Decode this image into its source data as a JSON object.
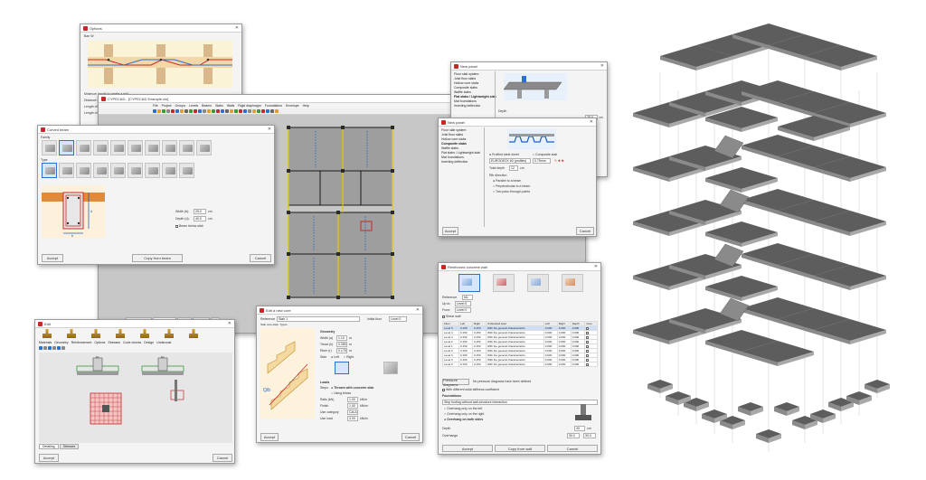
{
  "options_window": {
    "title": "Options",
    "section": "Ban W",
    "rows": [
      "Minimum length to create a mid...",
      "Distance between the lowest of 1...",
      "Length of the mid-span flat rod 0...",
      "Length of the bottom rebar..."
    ]
  },
  "main_window": {
    "title": "CYPECAD - [CYPECAD Example.cin]",
    "menu": [
      "File",
      "Project",
      "Groups",
      "Levels",
      "Beams",
      "Slabs",
      "Walls",
      "Rigid diaphragm",
      "Foundations",
      "Envelope",
      "Help"
    ],
    "bottom_tabs": [
      "Columns, Walls...",
      "Beams / Floors",
      "Results",
      "Isovalues",
      "3D"
    ],
    "status": "CYPECAD - CIVIL"
  },
  "curved_beam_window": {
    "title": "Curved beam",
    "family_label": "Family",
    "type_label": "Type",
    "width_label": "Width (b):",
    "width_value": "25.0",
    "width_unit": "cm",
    "depth_label": "Depth (d):",
    "depth_value": "40.0",
    "depth_unit": "cm",
    "below_slab_label": "Beam below slab",
    "accept": "Accept",
    "copy": "Copy from beam",
    "cancel": "Cancel",
    "dim_b": "b",
    "dim_d": "d"
  },
  "slab_window_1": {
    "title": "New panel",
    "tree": [
      "Floor slab system",
      "Joist floor slabs",
      "Hollow core slabs",
      "Composite slabs",
      "Waffle slabs",
      "Flat slabs / Lightweight slab",
      "Mat foundations",
      "Inverting deflection"
    ],
    "depth_label": "Depth",
    "depth_value": "25.0",
    "depth_unit": "cm",
    "lightweight": "Lightweight slab",
    "direction_label": "Direction of the longitudinal reinforcement",
    "opt1": "Parallel to a beam",
    "opt2": "Perpendicular to a beam"
  },
  "slab_window_2": {
    "title": "New panel",
    "tree": [
      "Floor slab system",
      "Joist floor slabs",
      "Hollow core slabs",
      "Composite slabs",
      "Waffle slabs",
      "Flat slabs / Lightweight slab",
      "Mat foundations",
      "Inverting deflection"
    ],
    "sheet_type": "Profiled steel sheet",
    "composite": "Composite slab",
    "profile": "EURODECK 60 (profiles)",
    "thickness": "0.75mm",
    "total_depth_label": "Total depth",
    "total_depth_value": "12",
    "total_depth_unit": "cm",
    "direction_label": "Rib direction",
    "opt1": "Parallel to a beam",
    "opt2": "Perpendicular to a beam",
    "opt3": "Two pass through points",
    "accept": "Accept",
    "cancel": "Cancel"
  },
  "wall_window": {
    "title": "Reinforced concrete wall",
    "ref_label": "Reference",
    "ref_value": "M1",
    "up_to_label": "Up to:",
    "up_to_value": "Level 5",
    "from_label": "From:",
    "from_value": "Level 0",
    "shear_wall": "Shear wall",
    "headers": [
      "Floor",
      "Left",
      "Right",
      "Unblocked load",
      "Left",
      "Right",
      "Depth",
      "Core"
    ],
    "rows": [
      [
        "Level 5",
        "0.150",
        "0.150",
        "With the general characteristics",
        "0.000",
        "0.000",
        "0.000",
        ""
      ],
      [
        "Level 4",
        "0.150",
        "0.150",
        "With the general characteristics",
        "0.000",
        "0.000",
        "0.000",
        ""
      ],
      [
        "Level 3",
        "0.150",
        "0.150",
        "With the general characteristics",
        "0.000",
        "0.000",
        "0.000",
        ""
      ],
      [
        "Level 2",
        "0.150",
        "0.150",
        "With the general characteristics",
        "0.000",
        "0.000",
        "0.000",
        ""
      ],
      [
        "Level 1",
        "0.150",
        "0.150",
        "With the general characteristics",
        "0.000",
        "0.000",
        "0.000",
        ""
      ],
      [
        "Level 0",
        "0.150",
        "0.150",
        "With the general characteristics",
        "0.000",
        "0.000",
        "0.000",
        ""
      ],
      [
        "Level 0",
        "0.150",
        "0.150",
        "With the general characteristics",
        "0.000",
        "0.000",
        "0.000",
        ""
      ],
      [
        "Level 0",
        "0.150",
        "0.150",
        "With the general characteristics",
        "0.000",
        "0.000",
        "0.000",
        ""
      ],
      [
        "Level 0",
        "0.150",
        "0.150",
        "With the general characteristics",
        "0.000",
        "0.000",
        "0.000",
        ""
      ]
    ],
    "pressure_btn": "Pressure diagrams",
    "pressure_note": "No pressure diagrams have been defined",
    "stiffness": "With different axial stiffness coefficient",
    "foundations_label": "Foundations",
    "foundation_type": "Strip footing without wall-structure interaction",
    "opt1": "Overhang only on the left",
    "opt2": "Overhang only on the right",
    "opt3": "Overhang on both sides",
    "depth_label": "Depth",
    "depth_value": "40",
    "depth_unit": "cm",
    "overhang_label": "Overhangs",
    "overhang_l": "30.0",
    "overhang_r": "30.0",
    "accept": "Accept",
    "copy": "Copy from wall",
    "cancel": "Cancel"
  },
  "stair_window": {
    "title": "Edit a new core",
    "ref_label": "Reference",
    "ref_value": "Stair 1",
    "initial_floor_label": "Initial floor",
    "initial_floor_value": "Level 0",
    "tabs": [
      "Stair core data",
      "Types"
    ],
    "geometry": "Geometry",
    "width_label": "Width (a)",
    "width_value": "1.10",
    "width_unit": "m",
    "tread_label": "Tread (h)",
    "tread_value": "0.280",
    "tread_unit": "m",
    "riser_label": "Riser (r)",
    "riser_value": "0.175",
    "riser_unit": "m",
    "stair_label": "Stair",
    "left": "Left",
    "right": "Right",
    "loads": "Loads",
    "steps_label": "Steps",
    "steps_opt1": "Thrown with concrete slab",
    "steps_opt2": "Using bricks",
    "rails_label": "Rails (kN)",
    "rails_value": "1.00",
    "rails_unit": "kN/m",
    "finish_label": "Finish",
    "finish_value": "1.00",
    "finish_unit": "kN/m²",
    "use_cat_label": "Use category",
    "use_cat_value": "Cat.A",
    "use_load_label": "Use load",
    "use_load_value": "3.00",
    "use_load_unit": "kN/m²",
    "dim_label": "Q/b",
    "accept": "Accept",
    "cancel": "Cancel"
  },
  "footing_window": {
    "title": "Edit",
    "tabs": [
      "Materials",
      "Geometry",
      "Reinforcement",
      "Options",
      "Stresses",
      "Code checks",
      "Design",
      "Undercoat"
    ],
    "bottom_tabs": [
      "Detailing",
      "Stresses"
    ],
    "accept": "Accept",
    "cancel": "Cancel",
    "dim1": "R1",
    "dim2": "R2"
  },
  "colors": {
    "accent": "#2a6fd1",
    "plan_bg": "#c7c7c7",
    "beam_yellow": "#e3c800",
    "slab_dark": "#5d5d5d",
    "slab_edge": "#8a8a8a"
  }
}
